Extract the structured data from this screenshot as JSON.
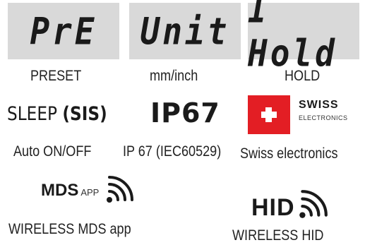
{
  "displays": [
    {
      "lcd": "PrE",
      "caption": "PRESET"
    },
    {
      "lcd": "Unit",
      "caption": "mm/inch"
    },
    {
      "lcd": "I Hold",
      "caption": "HOLD"
    }
  ],
  "features": {
    "sleep_text": "SLEEP",
    "sleep_sis": "(SIS)",
    "sleep_caption": "Auto ON/OFF",
    "ip_text": "IP67",
    "ip_caption": "IP 67 (IEC60529)",
    "swiss_title": "SWISS",
    "swiss_sub": "ELECTRONICS",
    "swiss_caption": "Swiss electronics",
    "mds_text": "MDS",
    "mds_app": "APP",
    "mds_caption": "WIRELESS MDS app",
    "hid_text": "HID",
    "hid_caption": "WIRELESS HID"
  },
  "colors": {
    "lcd_background": "#d9d9d9",
    "swiss_red": "#e31e24",
    "text": "#1e1e1e"
  },
  "icons": [
    "swiss-cross-icon",
    "wireless-signal-icon"
  ]
}
